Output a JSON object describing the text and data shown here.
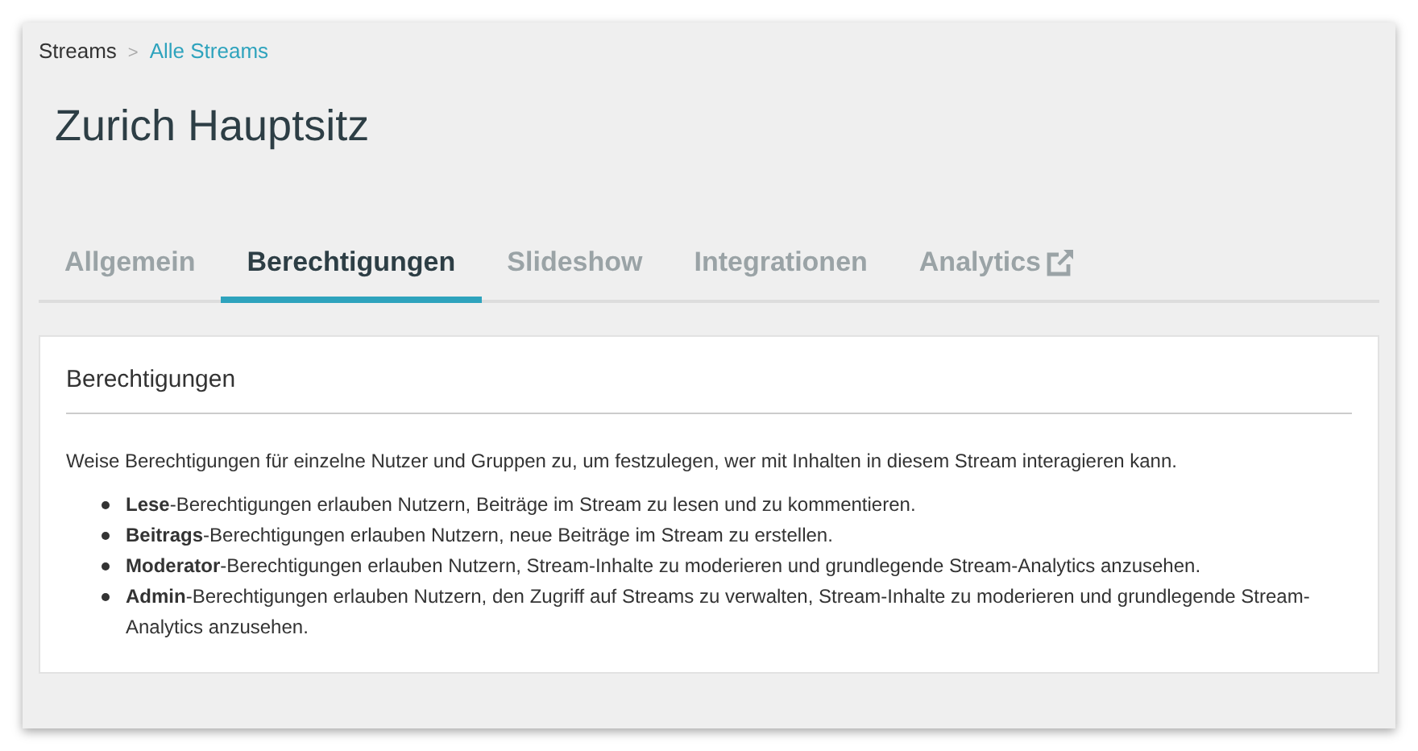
{
  "breadcrumb": [
    {
      "label": "Streams",
      "link": false
    },
    {
      "label": "Alle Streams",
      "link": true
    }
  ],
  "breadcrumb_separator": ">",
  "title": "Zurich Hauptsitz",
  "tabs": [
    {
      "label": "Allgemein",
      "selected": false,
      "external": false
    },
    {
      "label": "Berechtigungen",
      "selected": true,
      "external": false
    },
    {
      "label": "Slideshow",
      "selected": false,
      "external": false
    },
    {
      "label": "Integrationen",
      "selected": false,
      "external": false
    },
    {
      "label": "Analytics",
      "selected": false,
      "external": true
    }
  ],
  "card": {
    "heading": "Berechtigungen",
    "intro": "Weise Berechtigungen für einzelne Nutzer und Gruppen zu, um festzulegen, wer mit Inhalten in diesem Stream interagieren kann.",
    "items": [
      "**Lese**-Berechtigungen erlauben Nutzern, Beiträge im Stream zu lesen und zu kommentieren.",
      "**Beitrags**-Berechtigungen erlauben Nutzern, neue Beiträge im Stream zu erstellen.",
      "**Moderator**-Berechtigungen erlauben Nutzern, Stream-Inhalte zu moderieren und grundlegende Stream-Analytics anzusehen.",
      "**Admin**-Berechtigungen erlauben Nutzern, den Zugriff auf Streams zu verwalten, Stream-Inhalte zu moderieren und grundlegende Stream-Analytics anzusehen."
    ]
  }
}
